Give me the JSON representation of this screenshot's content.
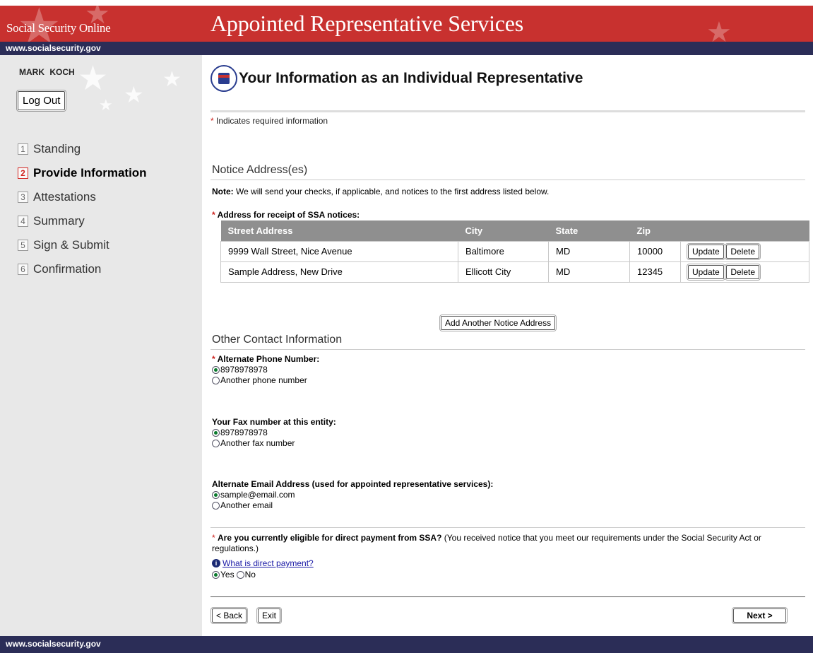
{
  "header": {
    "brand": "Social Security Online",
    "title": "Appointed Representative Services",
    "site_url": "www.socialsecurity.gov"
  },
  "sidebar": {
    "user_name": "MARK  KOCH",
    "logout_label": "Log Out",
    "steps": [
      {
        "num": "1",
        "label": "Standing",
        "active": false
      },
      {
        "num": "2",
        "label": "Provide Information",
        "active": true
      },
      {
        "num": "3",
        "label": "Attestations",
        "active": false
      },
      {
        "num": "4",
        "label": "Summary",
        "active": false
      },
      {
        "num": "5",
        "label": "Sign & Submit",
        "active": false
      },
      {
        "num": "6",
        "label": "Confirmation",
        "active": false
      }
    ]
  },
  "page": {
    "title": "Your Information as an Individual Representative",
    "required_marker": "*",
    "required_note": "Indicates required information"
  },
  "notice": {
    "heading": "Notice Address(es)",
    "note_bold": "Note:",
    "note_text": " We will send your checks, if applicable, and notices to the first address listed below.",
    "address_label": "Address for receipt of SSA notices:",
    "columns": [
      "Street Address",
      "City",
      "State",
      "Zip",
      ""
    ],
    "rows": [
      {
        "street": "9999 Wall Street, Nice Avenue",
        "city": "Baltimore",
        "state": "MD",
        "zip": "10000"
      },
      {
        "street": "Sample Address, New Drive",
        "city": "Ellicott City",
        "state": "MD",
        "zip": "12345"
      }
    ],
    "update_label": "Update",
    "delete_label": "Delete",
    "add_label": "Add Another Notice Address"
  },
  "contact": {
    "heading": "Other Contact Information",
    "phone_label": "Alternate Phone Number:",
    "phone_value": "8978978978",
    "phone_other": "Another phone number",
    "fax_label": "Your Fax number at this entity:",
    "fax_value": "8978978978",
    "fax_other": "Another fax number",
    "email_label": "Alternate Email Address (used for appointed representative services):",
    "email_value": "sample@email.com",
    "email_other": "Another email"
  },
  "payment": {
    "question": "Are you currently eligible for direct payment from SSA?",
    "question_detail": " (You received notice that you meet our requirements under the Social Security Act or regulations.)",
    "help_link": "What is direct payment?",
    "yes": "Yes",
    "no": "No",
    "selected": "Yes"
  },
  "nav": {
    "back_label": "< Back",
    "exit_label": "Exit",
    "next_label": "Next >"
  },
  "colors": {
    "header_red": "#c8312f",
    "navy_bar": "#2b2d57",
    "sidebar_bg": "#e8e8e8",
    "table_header": "#8f8f8f",
    "required_red": "#cc1f1a"
  }
}
